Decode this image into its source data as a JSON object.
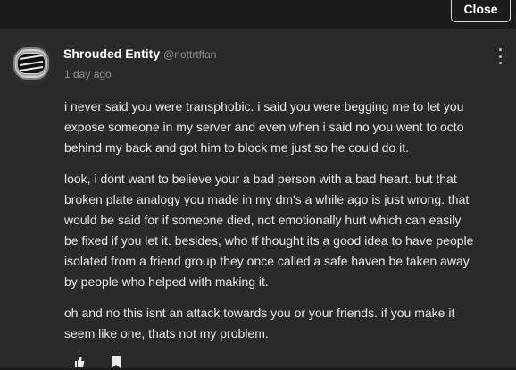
{
  "header": {
    "close_label": "Close"
  },
  "post": {
    "author": "Shrouded Entity",
    "handle": "@nottrtffan",
    "timestamp": "1 day ago",
    "avatar_icon": "helmet-avatar",
    "paragraphs": [
      [
        "i never said you were transphobic. i said you were begging me to let you",
        "expose someone in my server and even when i said no you went to octo",
        "behind my back and got him to block me just so he could do it."
      ],
      [
        "look, i dont want to believe your a bad person with a bad heart. but that",
        "broken plate analogy you made in my dm's a while ago is just wrong. that",
        "would be said for if someone died, not emotionally hurt which can easily",
        "be fixed if you let it. besides, who tf thought its a good idea to have people",
        "isolated from a friend group they once called a safe haven be taken away",
        "by people who helped with making it."
      ],
      [
        "oh and no this isnt an attack towards you or your friends. if you make it",
        "seem like one, thats not my problem."
      ]
    ],
    "action_icons": [
      "like-icon",
      "bookmark-icon"
    ]
  },
  "colors": {
    "page_background": "#1a1b1d",
    "card_background": "#292a2d",
    "text_primary": "#e9eaec",
    "text_muted": "#8e8f93"
  }
}
